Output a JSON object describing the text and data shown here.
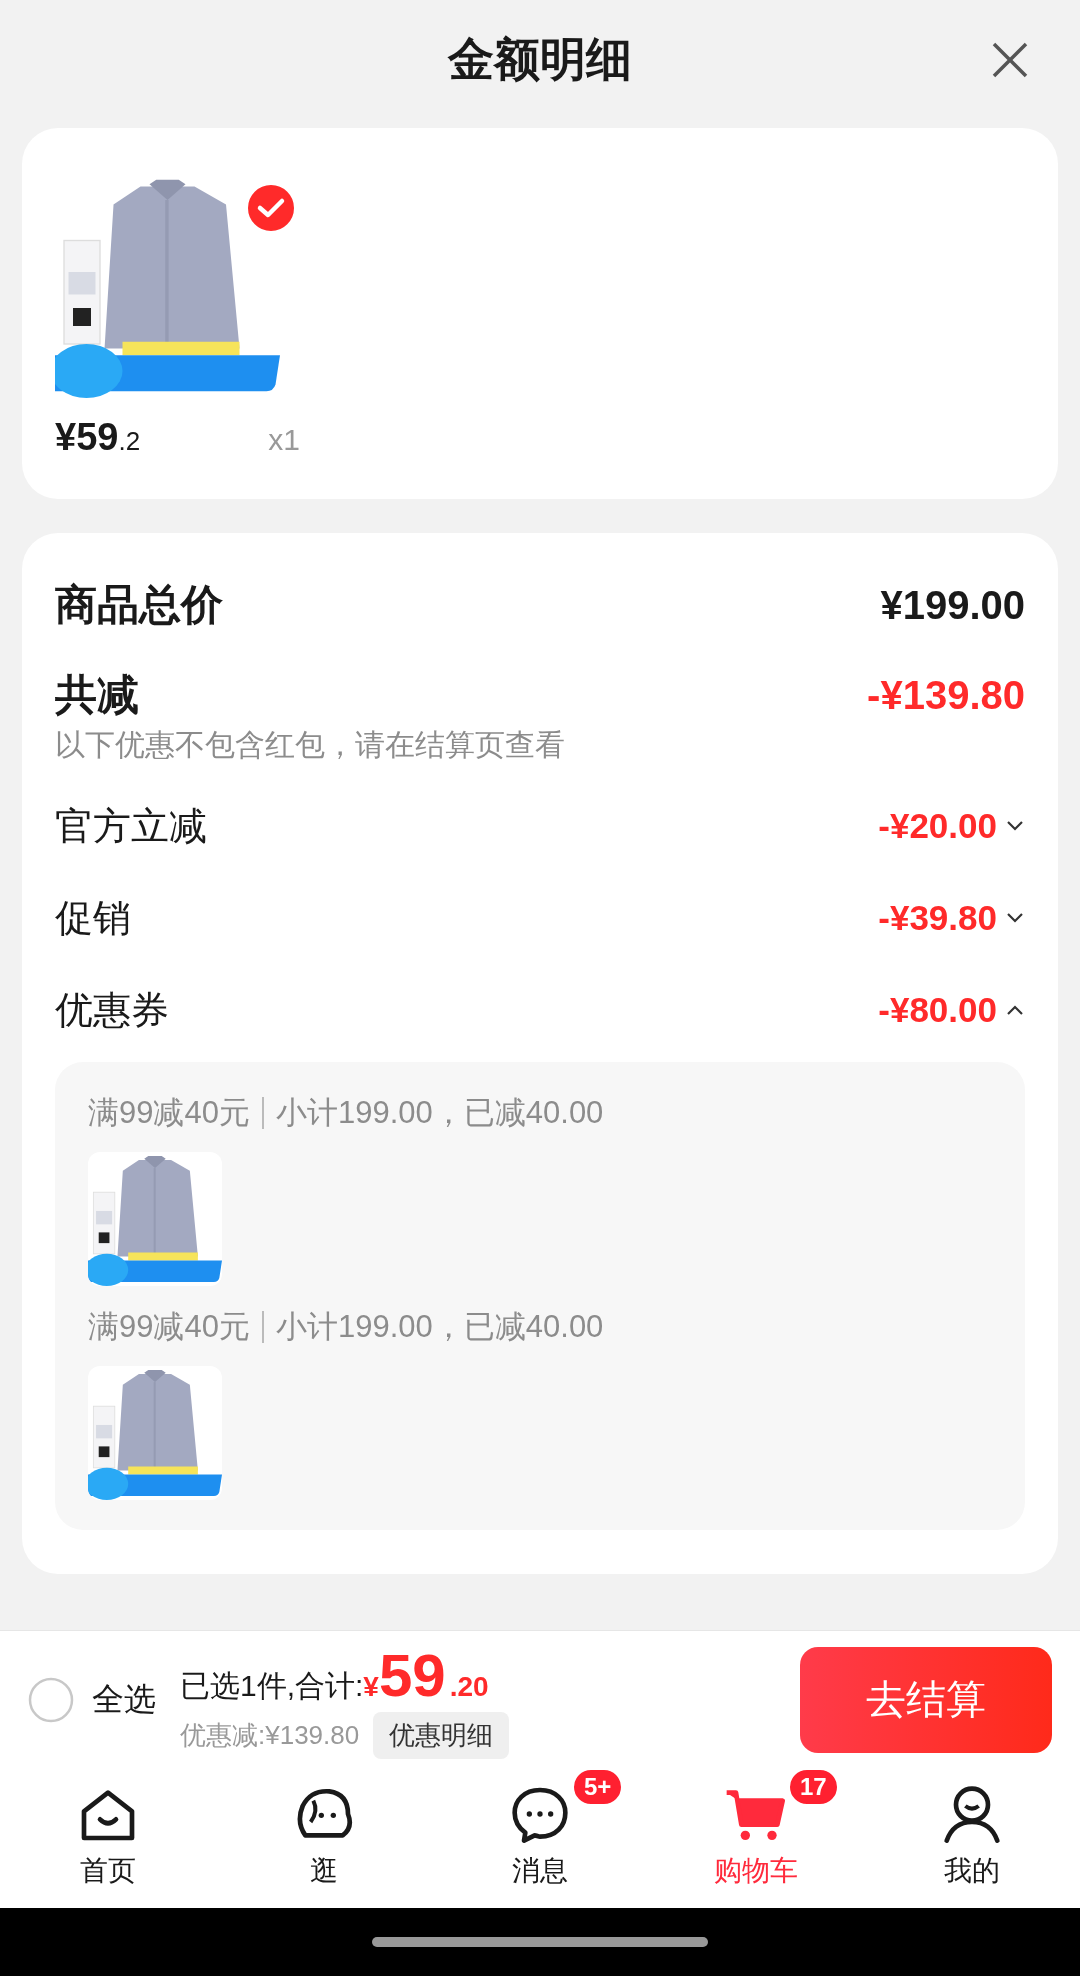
{
  "header": {
    "title": "金额明细"
  },
  "product": {
    "selected": true,
    "price_main": "¥59",
    "price_decimal": ".2",
    "quantity": "x1"
  },
  "summary": [
    {
      "kind": "total",
      "label": "商品总价",
      "amount": "¥199.00"
    },
    {
      "kind": "reduction",
      "label": "共减",
      "amount": "-¥139.80",
      "note": "以下优惠不包含红包，请在结算页查看"
    }
  ],
  "discounts": [
    {
      "label": "官方立减",
      "amount": "-¥20.00",
      "expanded": false
    },
    {
      "label": "促销",
      "amount": "-¥39.80",
      "expanded": false
    },
    {
      "label": "优惠券",
      "amount": "-¥80.00",
      "expanded": true,
      "groups": [
        {
          "rule": "满99减40元",
          "detail": "小计199.00，已减40.00"
        },
        {
          "rule": "满99减40元",
          "detail": "小计199.00，已减40.00"
        }
      ]
    }
  ],
  "checkout_bar": {
    "select_all": {
      "label": "全选",
      "checked": false
    },
    "selected_text": "已选1件,合计:",
    "currency": "¥",
    "total_main": "59",
    "total_decimal": ".20",
    "discount_text": "优惠减:¥139.80",
    "detail_button": "优惠明细",
    "checkout_button": "去结算"
  },
  "nav": [
    {
      "label": "首页",
      "selected": false
    },
    {
      "label": "逛",
      "selected": false
    },
    {
      "label": "消息",
      "selected": false,
      "badge": "5+"
    },
    {
      "label": "购物车",
      "selected": true,
      "badge": "17"
    },
    {
      "label": "我的",
      "selected": false
    }
  ]
}
